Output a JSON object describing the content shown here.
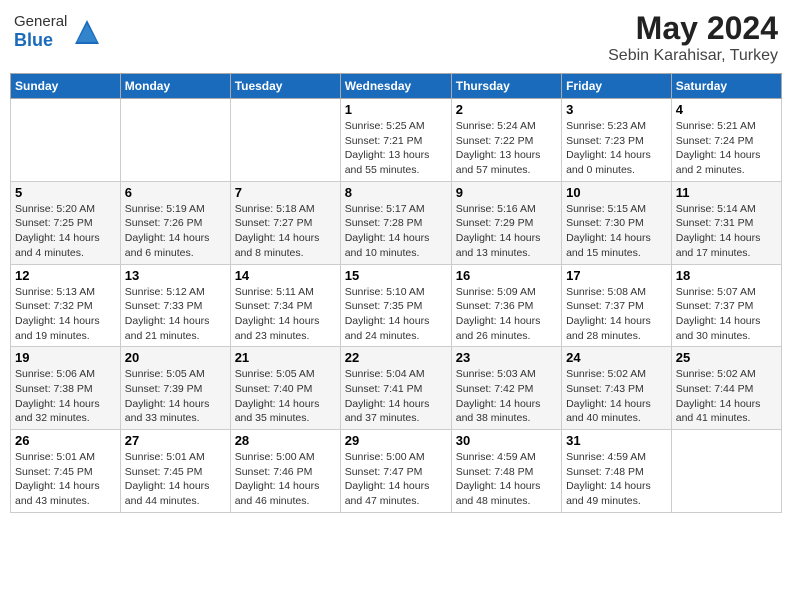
{
  "logo": {
    "general": "General",
    "blue": "Blue"
  },
  "title": "May 2024",
  "subtitle": "Sebin Karahisar, Turkey",
  "days_of_week": [
    "Sunday",
    "Monday",
    "Tuesday",
    "Wednesday",
    "Thursday",
    "Friday",
    "Saturday"
  ],
  "weeks": [
    [
      {
        "day": "",
        "info": ""
      },
      {
        "day": "",
        "info": ""
      },
      {
        "day": "",
        "info": ""
      },
      {
        "day": "1",
        "info": "Sunrise: 5:25 AM\nSunset: 7:21 PM\nDaylight: 13 hours\nand 55 minutes."
      },
      {
        "day": "2",
        "info": "Sunrise: 5:24 AM\nSunset: 7:22 PM\nDaylight: 13 hours\nand 57 minutes."
      },
      {
        "day": "3",
        "info": "Sunrise: 5:23 AM\nSunset: 7:23 PM\nDaylight: 14 hours\nand 0 minutes."
      },
      {
        "day": "4",
        "info": "Sunrise: 5:21 AM\nSunset: 7:24 PM\nDaylight: 14 hours\nand 2 minutes."
      }
    ],
    [
      {
        "day": "5",
        "info": "Sunrise: 5:20 AM\nSunset: 7:25 PM\nDaylight: 14 hours\nand 4 minutes."
      },
      {
        "day": "6",
        "info": "Sunrise: 5:19 AM\nSunset: 7:26 PM\nDaylight: 14 hours\nand 6 minutes."
      },
      {
        "day": "7",
        "info": "Sunrise: 5:18 AM\nSunset: 7:27 PM\nDaylight: 14 hours\nand 8 minutes."
      },
      {
        "day": "8",
        "info": "Sunrise: 5:17 AM\nSunset: 7:28 PM\nDaylight: 14 hours\nand 10 minutes."
      },
      {
        "day": "9",
        "info": "Sunrise: 5:16 AM\nSunset: 7:29 PM\nDaylight: 14 hours\nand 13 minutes."
      },
      {
        "day": "10",
        "info": "Sunrise: 5:15 AM\nSunset: 7:30 PM\nDaylight: 14 hours\nand 15 minutes."
      },
      {
        "day": "11",
        "info": "Sunrise: 5:14 AM\nSunset: 7:31 PM\nDaylight: 14 hours\nand 17 minutes."
      }
    ],
    [
      {
        "day": "12",
        "info": "Sunrise: 5:13 AM\nSunset: 7:32 PM\nDaylight: 14 hours\nand 19 minutes."
      },
      {
        "day": "13",
        "info": "Sunrise: 5:12 AM\nSunset: 7:33 PM\nDaylight: 14 hours\nand 21 minutes."
      },
      {
        "day": "14",
        "info": "Sunrise: 5:11 AM\nSunset: 7:34 PM\nDaylight: 14 hours\nand 23 minutes."
      },
      {
        "day": "15",
        "info": "Sunrise: 5:10 AM\nSunset: 7:35 PM\nDaylight: 14 hours\nand 24 minutes."
      },
      {
        "day": "16",
        "info": "Sunrise: 5:09 AM\nSunset: 7:36 PM\nDaylight: 14 hours\nand 26 minutes."
      },
      {
        "day": "17",
        "info": "Sunrise: 5:08 AM\nSunset: 7:37 PM\nDaylight: 14 hours\nand 28 minutes."
      },
      {
        "day": "18",
        "info": "Sunrise: 5:07 AM\nSunset: 7:37 PM\nDaylight: 14 hours\nand 30 minutes."
      }
    ],
    [
      {
        "day": "19",
        "info": "Sunrise: 5:06 AM\nSunset: 7:38 PM\nDaylight: 14 hours\nand 32 minutes."
      },
      {
        "day": "20",
        "info": "Sunrise: 5:05 AM\nSunset: 7:39 PM\nDaylight: 14 hours\nand 33 minutes."
      },
      {
        "day": "21",
        "info": "Sunrise: 5:05 AM\nSunset: 7:40 PM\nDaylight: 14 hours\nand 35 minutes."
      },
      {
        "day": "22",
        "info": "Sunrise: 5:04 AM\nSunset: 7:41 PM\nDaylight: 14 hours\nand 37 minutes."
      },
      {
        "day": "23",
        "info": "Sunrise: 5:03 AM\nSunset: 7:42 PM\nDaylight: 14 hours\nand 38 minutes."
      },
      {
        "day": "24",
        "info": "Sunrise: 5:02 AM\nSunset: 7:43 PM\nDaylight: 14 hours\nand 40 minutes."
      },
      {
        "day": "25",
        "info": "Sunrise: 5:02 AM\nSunset: 7:44 PM\nDaylight: 14 hours\nand 41 minutes."
      }
    ],
    [
      {
        "day": "26",
        "info": "Sunrise: 5:01 AM\nSunset: 7:45 PM\nDaylight: 14 hours\nand 43 minutes."
      },
      {
        "day": "27",
        "info": "Sunrise: 5:01 AM\nSunset: 7:45 PM\nDaylight: 14 hours\nand 44 minutes."
      },
      {
        "day": "28",
        "info": "Sunrise: 5:00 AM\nSunset: 7:46 PM\nDaylight: 14 hours\nand 46 minutes."
      },
      {
        "day": "29",
        "info": "Sunrise: 5:00 AM\nSunset: 7:47 PM\nDaylight: 14 hours\nand 47 minutes."
      },
      {
        "day": "30",
        "info": "Sunrise: 4:59 AM\nSunset: 7:48 PM\nDaylight: 14 hours\nand 48 minutes."
      },
      {
        "day": "31",
        "info": "Sunrise: 4:59 AM\nSunset: 7:48 PM\nDaylight: 14 hours\nand 49 minutes."
      },
      {
        "day": "",
        "info": ""
      }
    ]
  ]
}
